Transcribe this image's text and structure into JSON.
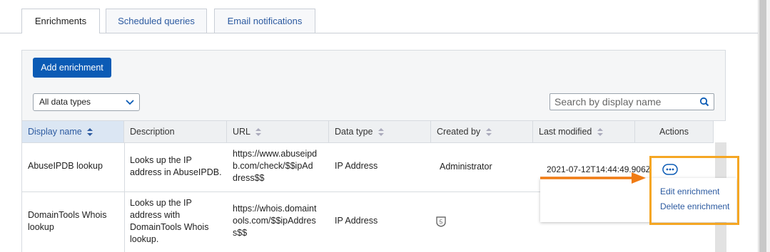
{
  "tabs": [
    {
      "label": "Enrichments",
      "active": true
    },
    {
      "label": "Scheduled queries",
      "active": false
    },
    {
      "label": "Email notifications",
      "active": false
    }
  ],
  "toolbar": {
    "add_label": "Add enrichment"
  },
  "filter": {
    "selected": "All data types"
  },
  "search": {
    "placeholder": "Search by display name"
  },
  "table": {
    "headers": [
      "Display name",
      "Description",
      "URL",
      "Data type",
      "Created by",
      "Last modified",
      "Actions"
    ],
    "rows": [
      {
        "display_name": "AbuseIPDB lookup",
        "description": [
          "Looks up the IP",
          "address in AbuseIPDB."
        ],
        "url": [
          "https://www.abuseipd",
          "b.com/check/$$ipAd",
          "dress$$"
        ],
        "data_type": "IP Address",
        "created_by": "Administrator",
        "last_modified": "2021-07-12T14:44:49.906Z"
      },
      {
        "display_name": [
          "DomainTools Whois",
          "lookup"
        ],
        "description": [
          "Looks up the IP",
          "address with",
          "DomainTools Whois",
          "lookup."
        ],
        "url": [
          "https://whois.domaint",
          "ools.com/$$ipAddres",
          "s$$"
        ],
        "data_type": "IP Address",
        "created_by_icon": "sophos-badge-icon",
        "last_modified": ""
      }
    ]
  },
  "actions_menu": {
    "items": [
      "Edit enrichment",
      "Delete enrichment"
    ],
    "trigger_icon": "more-dots-icon"
  },
  "colors": {
    "accent": "#0b5bb5",
    "highlight": "#f5a623",
    "arrow": "#f07b13",
    "link": "#2c5aa0"
  }
}
